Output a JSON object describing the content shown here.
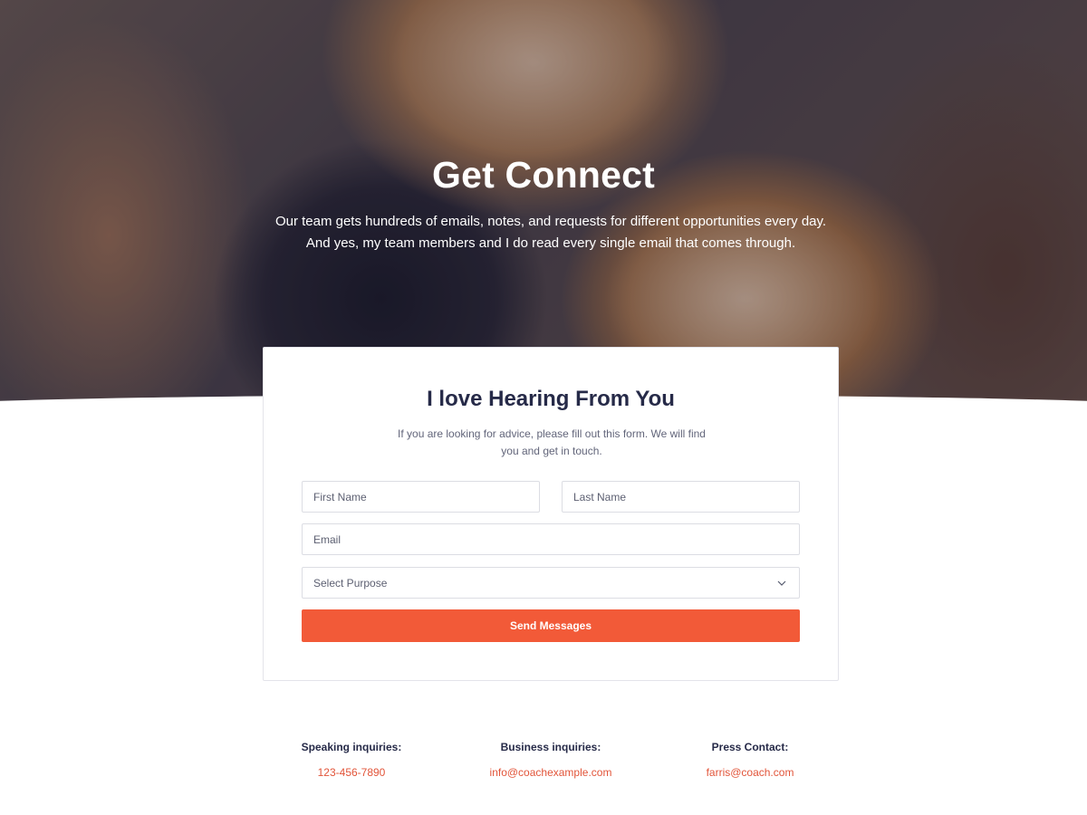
{
  "hero": {
    "title": "Get Connect",
    "description": "Our team gets hundreds of emails, notes, and requests for different opportunities every day. And yes, my team members and I do read every single email that comes through."
  },
  "form": {
    "title": "I love Hearing From You",
    "description": "If you are looking for advice, please fill out this form. We will find you and get in touch.",
    "first_name_placeholder": "First Name",
    "last_name_placeholder": "Last Name",
    "email_placeholder": "Email",
    "purpose_selected": "Select Purpose",
    "submit_label": "Send Messages"
  },
  "contacts": [
    {
      "label": "Speaking inquiries:",
      "value": "123-456-7890"
    },
    {
      "label": "Business inquiries:",
      "value": "info@coachexample.com"
    },
    {
      "label": "Press Contact:",
      "value": "farris@coach.com"
    }
  ],
  "colors": {
    "accent": "#f25a38",
    "link": "#e2553a",
    "heading": "#262a48",
    "hero_overlay": "#14162d"
  },
  "icons": {
    "select_chevron": "chevron-down-icon"
  }
}
